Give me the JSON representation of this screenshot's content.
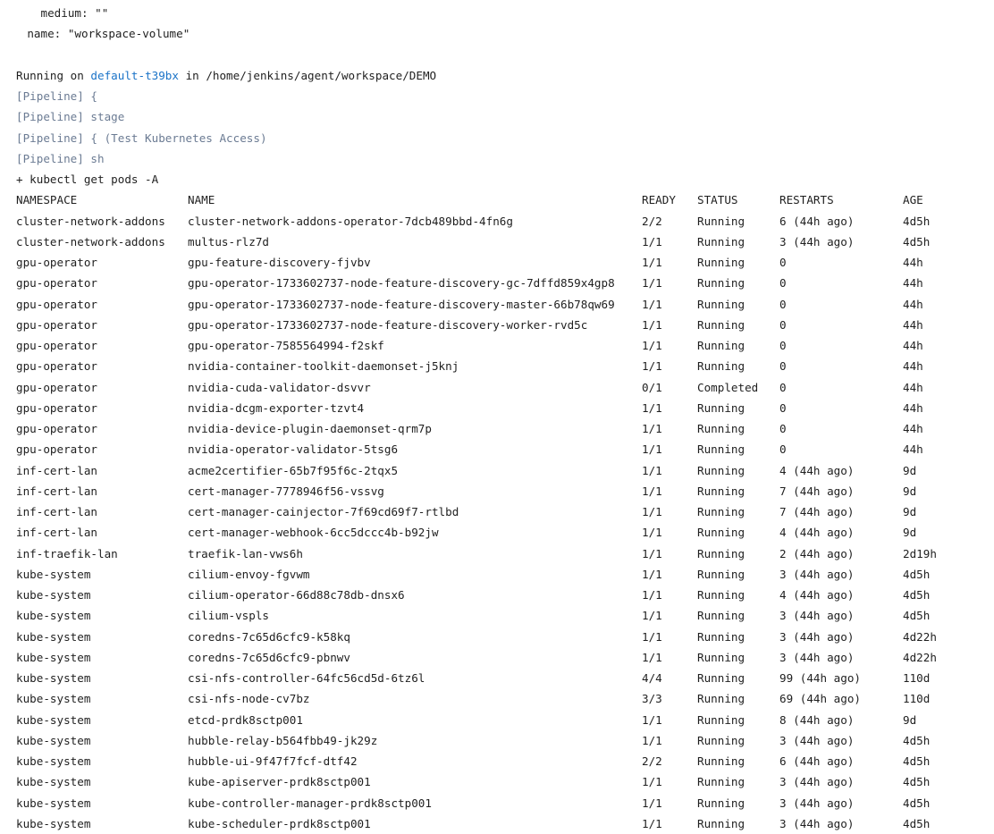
{
  "yaml_tail": {
    "medium_line": "      medium: \"\"",
    "name_line": "    name: \"workspace-volume\""
  },
  "running": {
    "prefix": "Running on ",
    "agent_link": "default-t39bx",
    "suffix": " in /home/jenkins/agent/workspace/DEMO"
  },
  "pipeline_lines": [
    "[Pipeline] {",
    "[Pipeline] stage",
    "[Pipeline] { (Test Kubernetes Access)",
    "[Pipeline] sh"
  ],
  "command": "+ kubectl get pods -A",
  "table": {
    "headers": [
      "NAMESPACE",
      "NAME",
      "READY",
      "STATUS",
      "RESTARTS",
      "AGE"
    ],
    "rows": [
      [
        "cluster-network-addons",
        "cluster-network-addons-operator-7dcb489bbd-4fn6g",
        "2/2",
        "Running",
        "6 (44h ago)",
        "4d5h"
      ],
      [
        "cluster-network-addons",
        "multus-rlz7d",
        "1/1",
        "Running",
        "3 (44h ago)",
        "4d5h"
      ],
      [
        "gpu-operator",
        "gpu-feature-discovery-fjvbv",
        "1/1",
        "Running",
        "0",
        "44h"
      ],
      [
        "gpu-operator",
        "gpu-operator-1733602737-node-feature-discovery-gc-7dffd859x4gp8",
        "1/1",
        "Running",
        "0",
        "44h"
      ],
      [
        "gpu-operator",
        "gpu-operator-1733602737-node-feature-discovery-master-66b78qw69",
        "1/1",
        "Running",
        "0",
        "44h"
      ],
      [
        "gpu-operator",
        "gpu-operator-1733602737-node-feature-discovery-worker-rvd5c",
        "1/1",
        "Running",
        "0",
        "44h"
      ],
      [
        "gpu-operator",
        "gpu-operator-7585564994-f2skf",
        "1/1",
        "Running",
        "0",
        "44h"
      ],
      [
        "gpu-operator",
        "nvidia-container-toolkit-daemonset-j5knj",
        "1/1",
        "Running",
        "0",
        "44h"
      ],
      [
        "gpu-operator",
        "nvidia-cuda-validator-dsvvr",
        "0/1",
        "Completed",
        "0",
        "44h"
      ],
      [
        "gpu-operator",
        "nvidia-dcgm-exporter-tzvt4",
        "1/1",
        "Running",
        "0",
        "44h"
      ],
      [
        "gpu-operator",
        "nvidia-device-plugin-daemonset-qrm7p",
        "1/1",
        "Running",
        "0",
        "44h"
      ],
      [
        "gpu-operator",
        "nvidia-operator-validator-5tsg6",
        "1/1",
        "Running",
        "0",
        "44h"
      ],
      [
        "inf-cert-lan",
        "acme2certifier-65b7f95f6c-2tqx5",
        "1/1",
        "Running",
        "4 (44h ago)",
        "9d"
      ],
      [
        "inf-cert-lan",
        "cert-manager-7778946f56-vssvg",
        "1/1",
        "Running",
        "7 (44h ago)",
        "9d"
      ],
      [
        "inf-cert-lan",
        "cert-manager-cainjector-7f69cd69f7-rtlbd",
        "1/1",
        "Running",
        "7 (44h ago)",
        "9d"
      ],
      [
        "inf-cert-lan",
        "cert-manager-webhook-6cc5dccc4b-b92jw",
        "1/1",
        "Running",
        "4 (44h ago)",
        "9d"
      ],
      [
        "inf-traefik-lan",
        "traefik-lan-vws6h",
        "1/1",
        "Running",
        "2 (44h ago)",
        "2d19h"
      ],
      [
        "kube-system",
        "cilium-envoy-fgvwm",
        "1/1",
        "Running",
        "3 (44h ago)",
        "4d5h"
      ],
      [
        "kube-system",
        "cilium-operator-66d88c78db-dnsx6",
        "1/1",
        "Running",
        "4 (44h ago)",
        "4d5h"
      ],
      [
        "kube-system",
        "cilium-vspls",
        "1/1",
        "Running",
        "3 (44h ago)",
        "4d5h"
      ],
      [
        "kube-system",
        "coredns-7c65d6cfc9-k58kq",
        "1/1",
        "Running",
        "3 (44h ago)",
        "4d22h"
      ],
      [
        "kube-system",
        "coredns-7c65d6cfc9-pbnwv",
        "1/1",
        "Running",
        "3 (44h ago)",
        "4d22h"
      ],
      [
        "kube-system",
        "csi-nfs-controller-64fc56cd5d-6tz6l",
        "4/4",
        "Running",
        "99 (44h ago)",
        "110d"
      ],
      [
        "kube-system",
        "csi-nfs-node-cv7bz",
        "3/3",
        "Running",
        "69 (44h ago)",
        "110d"
      ],
      [
        "kube-system",
        "etcd-prdk8sctp001",
        "1/1",
        "Running",
        "8 (44h ago)",
        "9d"
      ],
      [
        "kube-system",
        "hubble-relay-b564fbb49-jk29z",
        "1/1",
        "Running",
        "3 (44h ago)",
        "4d5h"
      ],
      [
        "kube-system",
        "hubble-ui-9f47f7fcf-dtf42",
        "2/2",
        "Running",
        "6 (44h ago)",
        "4d5h"
      ],
      [
        "kube-system",
        "kube-apiserver-prdk8sctp001",
        "1/1",
        "Running",
        "3 (44h ago)",
        "4d5h"
      ],
      [
        "kube-system",
        "kube-controller-manager-prdk8sctp001",
        "1/1",
        "Running",
        "3 (44h ago)",
        "4d5h"
      ],
      [
        "kube-system",
        "kube-scheduler-prdk8sctp001",
        "1/1",
        "Running",
        "3 (44h ago)",
        "4d5h"
      ]
    ]
  },
  "colors": {
    "text": "#1f1f1f",
    "pipeline": "#6b7b93",
    "link": "#1a73c8",
    "background": "#ffffff"
  }
}
